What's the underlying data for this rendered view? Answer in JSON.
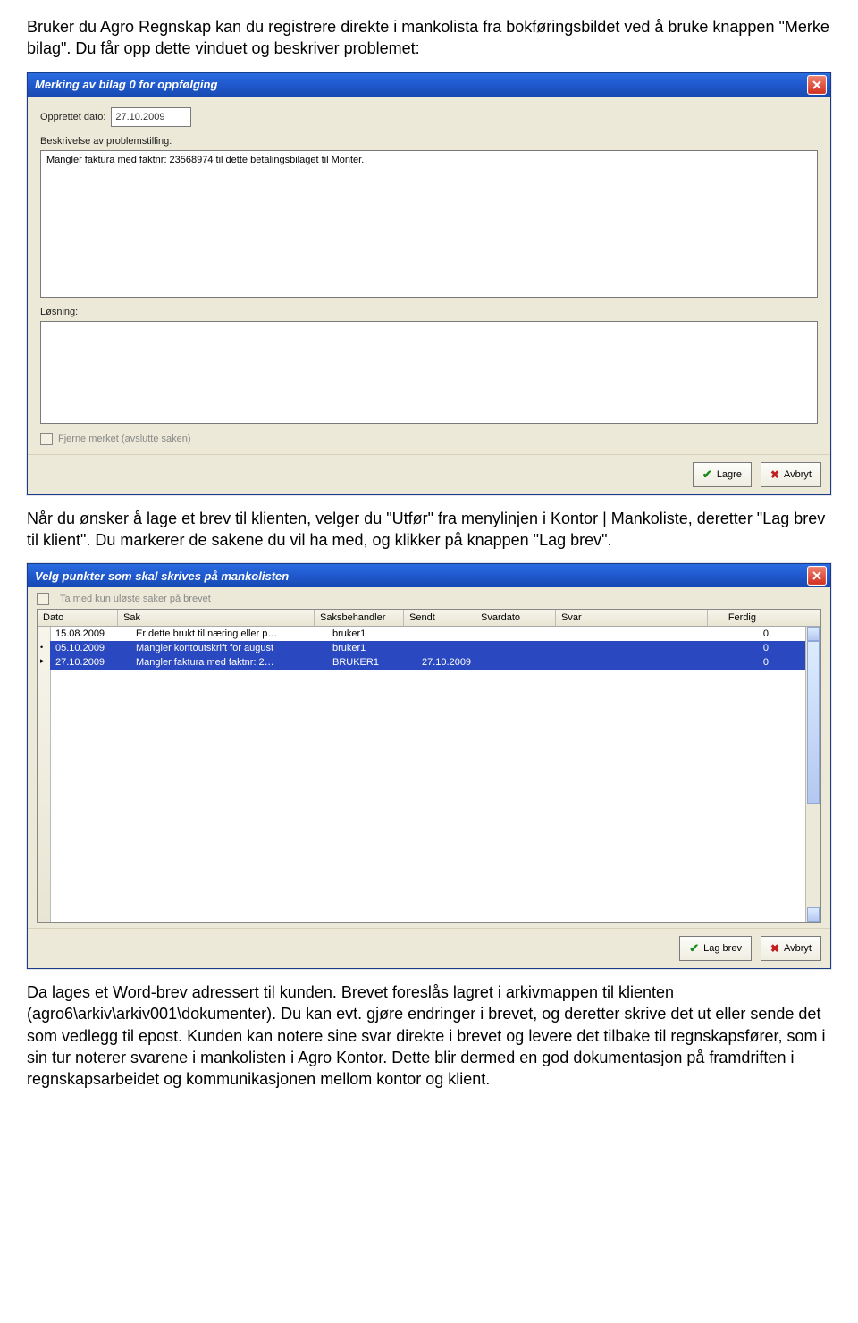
{
  "doc": {
    "para1": "Bruker du Agro Regnskap kan du registrere direkte i mankolista fra bokføringsbildet ved å bruke knappen \"Merke bilag\". Du får opp dette vinduet og beskriver problemet:",
    "para2": "Når du ønsker å lage et brev til klienten, velger du \"Utfør\" fra menylinjen i Kontor | Mankoliste, deretter \"Lag brev til klient\". Du markerer de sakene du vil ha med, og klikker på knappen \"Lag brev\".",
    "para3": "Da lages et Word-brev adressert til kunden. Brevet foreslås lagret i arkivmappen til klienten (agro6\\arkiv\\arkiv001\\dokumenter). Du kan evt. gjøre endringer i brevet, og deretter skrive det ut eller sende det som vedlegg til epost. Kunden kan notere sine svar direkte i brevet og levere det tilbake til regnskapsfører, som i sin tur noterer svarene i mankolisten i Agro Kontor. Dette blir dermed en god dokumentasjon på framdriften i regnskapsarbeidet og kommunikasjonen mellom kontor og klient."
  },
  "dialog1": {
    "title": "Merking av bilag 0 for oppfølging",
    "created_label": "Opprettet dato:",
    "created_value": "27.10.2009",
    "desc_label": "Beskrivelse av problemstilling:",
    "desc_value": "Mangler faktura  med faktnr: 23568974 til dette betalingsbilaget til Monter.",
    "solution_label": "Løsning:",
    "close_chk_label": "Fjerne merket (avslutte saken)",
    "btn_save": "Lagre",
    "btn_cancel": "Avbryt"
  },
  "dialog2": {
    "title": "Velg punkter som skal skrives på mankolisten",
    "top_chk_label": "Ta med kun uløste saker på brevet",
    "columns": {
      "dato": "Dato",
      "sak": "Sak",
      "saksbehandler": "Saksbehandler",
      "sendt": "Sendt",
      "svardato": "Svardato",
      "svar": "Svar",
      "ferdig": "Ferdig"
    },
    "rows": [
      {
        "dato": "15.08.2009",
        "sak": "Er dette brukt til næring eller p…",
        "saksbehandler": "bruker1",
        "sendt": "",
        "svardato": "",
        "svar": "",
        "ferdig": "0",
        "sel": false
      },
      {
        "dato": "05.10.2009",
        "sak": "Mangler kontoutskrift for august",
        "saksbehandler": "bruker1",
        "sendt": "",
        "svardato": "",
        "svar": "",
        "ferdig": "0",
        "sel": true
      },
      {
        "dato": "27.10.2009",
        "sak": "Mangler faktura med faktnr: 2…",
        "saksbehandler": "BRUKER1",
        "sendt": "27.10.2009",
        "svardato": "",
        "svar": "",
        "ferdig": "0",
        "sel": true
      }
    ],
    "btn_make": "Lag brev",
    "btn_cancel": "Avbryt"
  }
}
